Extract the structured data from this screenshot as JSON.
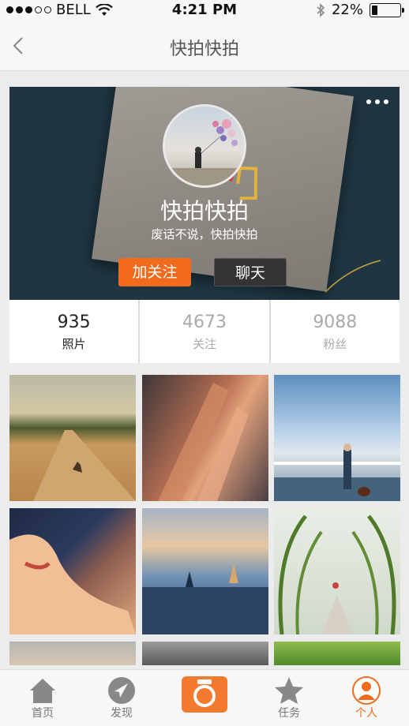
{
  "status_bar": {
    "carrier": "BELL",
    "time": "4:21 PM",
    "battery": "22%",
    "battery_level": 0.22
  },
  "nav": {
    "title": "快拍快拍"
  },
  "profile": {
    "name": "快拍快拍",
    "bio": "废话不说，快拍快拍",
    "follow_label": "加关注",
    "chat_label": "聊天"
  },
  "stats": [
    {
      "value": "935",
      "label": "照片"
    },
    {
      "value": "4673",
      "label": "关注"
    },
    {
      "value": "9088",
      "label": "粉丝"
    }
  ],
  "photos": [
    {
      "subject": "desert road with kangaroo"
    },
    {
      "subject": "legs in light and shadow"
    },
    {
      "subject": "man and dog at railing"
    },
    {
      "subject": "woman face with light"
    },
    {
      "subject": "temples at dusk"
    },
    {
      "subject": "green tunnel path"
    },
    {
      "subject": "beach"
    },
    {
      "subject": "twigs"
    },
    {
      "subject": "leaves"
    }
  ],
  "tabbar": {
    "items": [
      {
        "label": "首页",
        "icon": "home-icon"
      },
      {
        "label": "发现",
        "icon": "compass-icon"
      },
      {
        "label": "",
        "icon": "camera-icon"
      },
      {
        "label": "任务",
        "icon": "star-icon"
      },
      {
        "label": "个人",
        "icon": "person-icon",
        "active": true
      }
    ]
  },
  "colors": {
    "accent": "#f26b1d",
    "dark_button": "#333333"
  }
}
